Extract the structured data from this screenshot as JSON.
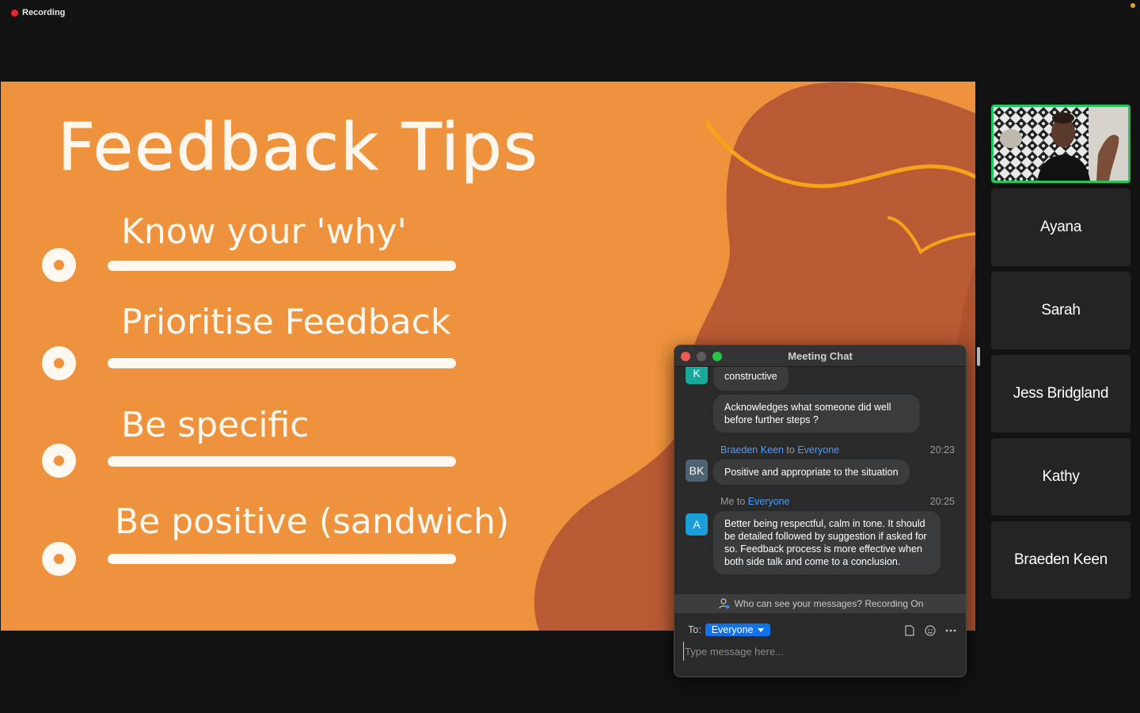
{
  "status": {
    "recording_label": "Recording"
  },
  "slide": {
    "title": "Feedback Tips",
    "tips": [
      "Know your 'why'",
      "Prioritise Feedback",
      "Be specific",
      "Be positive (sandwich)"
    ],
    "colors": {
      "background": "#ee923d",
      "shape": "#b85a34",
      "shape_dark": "#a24c2c",
      "accent_line": "#f7a21b"
    }
  },
  "participants": {
    "self_video": "camera-feed",
    "tiles": [
      "Ayana",
      "Sarah",
      "Jess Bridgland",
      "Kathy",
      "Braeden Keen"
    ]
  },
  "chat": {
    "title": "Meeting Chat",
    "messages": [
      {
        "avatar": "K",
        "avatar_color": "#1aa89a",
        "text": "constructive"
      },
      {
        "text": "Acknowledges what someone did well before further steps ?"
      },
      {
        "sender": "Braeden Keen",
        "to_word": "to",
        "recipient": "Everyone",
        "time": "20:23",
        "avatar": "BK",
        "avatar_color": "#4d6373",
        "text": "Positive and appropriate to the situation"
      },
      {
        "sender": "Me",
        "to_word": "to",
        "recipient": "Everyone",
        "time": "20:25",
        "avatar": "A",
        "avatar_color": "#1a9fd9",
        "text": "Better being respectful, calm in tone. It should be detailed followed by suggestion if asked for so. Feedback process is more effective when both side talk and come to a conclusion."
      }
    ],
    "privacy_text": "Who can see your messages? Recording On",
    "to_label": "To:",
    "recipient_select": "Everyone",
    "input_placeholder": "Type message here..."
  }
}
